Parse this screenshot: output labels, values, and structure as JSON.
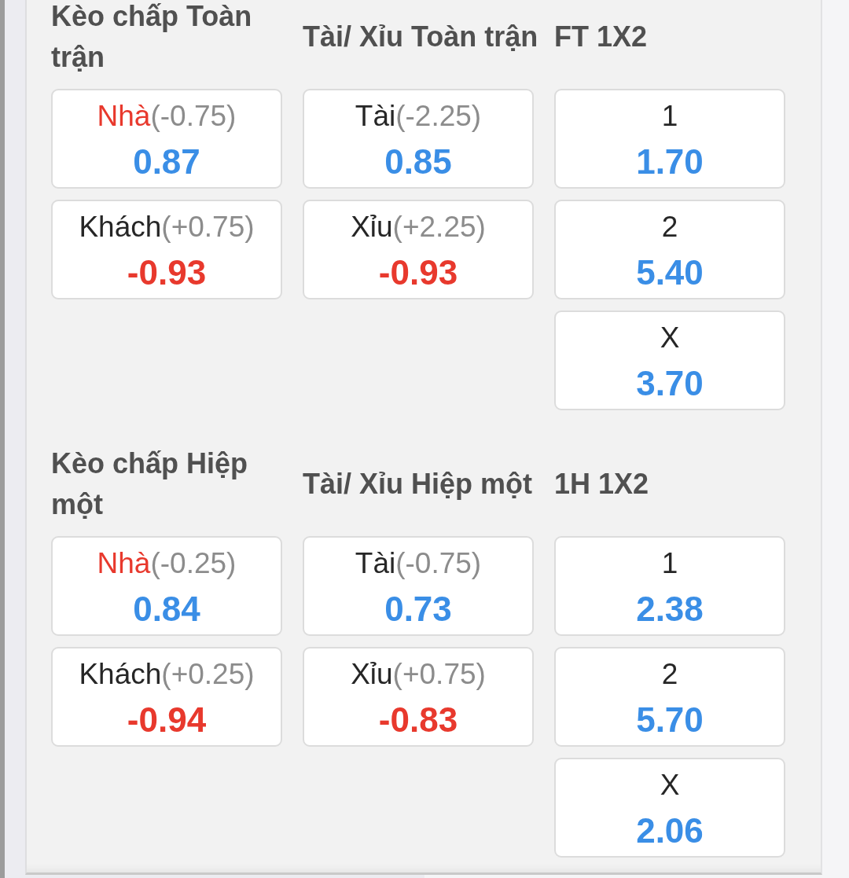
{
  "sections": [
    {
      "markets": [
        {
          "title": "Kèo chấp Toàn trận",
          "outcomes": [
            {
              "label": "Nhà",
              "line": "(-0.75)",
              "odds": "0.87",
              "favored": true,
              "negative": false
            },
            {
              "label": "Khách",
              "line": "(+0.75)",
              "odds": "-0.93",
              "favored": false,
              "negative": true
            }
          ]
        },
        {
          "title": "Tài/ Xỉu Toàn trận",
          "outcomes": [
            {
              "label": "Tài",
              "line": "(-2.25)",
              "odds": "0.85",
              "favored": false,
              "negative": false
            },
            {
              "label": "Xỉu",
              "line": "(+2.25)",
              "odds": "-0.93",
              "favored": false,
              "negative": true
            }
          ]
        },
        {
          "title": "FT 1X2",
          "outcomes": [
            {
              "label": "1",
              "odds": "1.70",
              "favored": false,
              "negative": false
            },
            {
              "label": "2",
              "odds": "5.40",
              "favored": false,
              "negative": false
            },
            {
              "label": "X",
              "odds": "3.70",
              "favored": false,
              "negative": false
            }
          ]
        }
      ]
    },
    {
      "markets": [
        {
          "title": "Kèo chấp Hiệp một",
          "outcomes": [
            {
              "label": "Nhà",
              "line": "(-0.25)",
              "odds": "0.84",
              "favored": true,
              "negative": false
            },
            {
              "label": "Khách",
              "line": "(+0.25)",
              "odds": "-0.94",
              "favored": false,
              "negative": true
            }
          ]
        },
        {
          "title": "Tài/ Xỉu Hiệp một",
          "outcomes": [
            {
              "label": "Tài",
              "line": "(-0.75)",
              "odds": "0.73",
              "favored": false,
              "negative": false
            },
            {
              "label": "Xỉu",
              "line": "(+0.75)",
              "odds": "-0.83",
              "favored": false,
              "negative": true
            }
          ]
        },
        {
          "title": "1H 1X2",
          "outcomes": [
            {
              "label": "1",
              "odds": "2.38",
              "favored": false,
              "negative": false
            },
            {
              "label": "2",
              "odds": "5.70",
              "favored": false,
              "negative": false
            },
            {
              "label": "X",
              "odds": "2.06",
              "favored": false,
              "negative": false
            }
          ]
        }
      ]
    }
  ]
}
